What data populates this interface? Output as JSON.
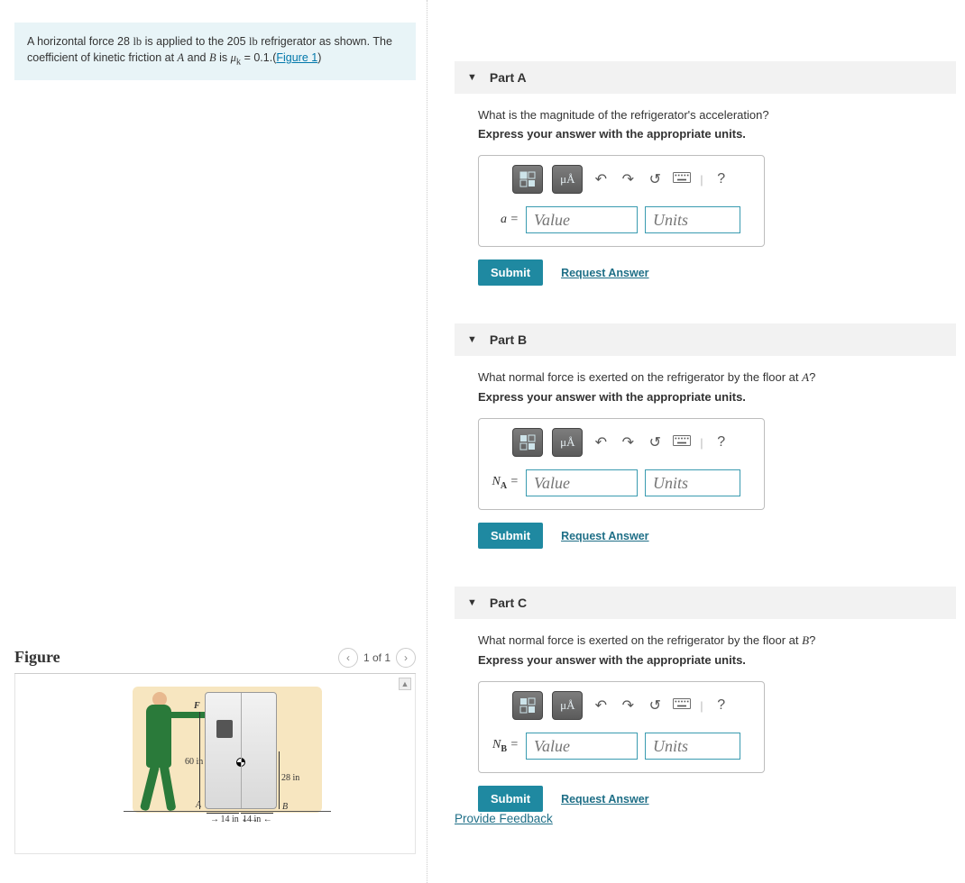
{
  "problem": {
    "text_pre": "A horizontal force 28 ",
    "unit1": "lb",
    "text_mid": " is applied to the 205 ",
    "unit2": "lb",
    "text_post": " refrigerator as shown. The coefficient of kinetic friction at ",
    "varA": "A",
    "and": " and ",
    "varB": "B",
    "is": " is ",
    "mu": "μ",
    "sub": "k",
    "eq": " = 0.1.(",
    "figure_link": "Figure 1",
    "close": ")"
  },
  "figure": {
    "title": "Figure",
    "pager": "1 of 1",
    "labels": {
      "F": "F",
      "h60": "60 in",
      "h28": "28 in",
      "w14a": "14 in",
      "w14b": "14 in",
      "A": "A",
      "B": "B"
    }
  },
  "parts": [
    {
      "title": "Part A",
      "question": "What is the magnitude of the refrigerator's acceleration?",
      "instruction": "Express your answer with the appropriate units.",
      "varlabel": "a",
      "value_ph": "Value",
      "units_ph": "Units",
      "submit": "Submit",
      "request": "Request Answer"
    },
    {
      "title": "Part B",
      "question_pre": "What normal force is exerted on the refrigerator by the floor at ",
      "question_var": "A",
      "question_post": "?",
      "instruction": "Express your answer with the appropriate units.",
      "varlabel_base": "N",
      "varlabel_sub": "A",
      "value_ph": "Value",
      "units_ph": "Units",
      "submit": "Submit",
      "request": "Request Answer"
    },
    {
      "title": "Part C",
      "question_pre": "What normal force is exerted on the refrigerator by the floor at ",
      "question_var": "B",
      "question_post": "?",
      "instruction": "Express your answer with the appropriate units.",
      "varlabel_base": "N",
      "varlabel_sub": "B",
      "value_ph": "Value",
      "units_ph": "Units",
      "submit": "Submit",
      "request": "Request Answer"
    }
  ],
  "toolbar": {
    "mu_btn": "μÅ",
    "help": "?"
  },
  "feedback": "Provide Feedback"
}
